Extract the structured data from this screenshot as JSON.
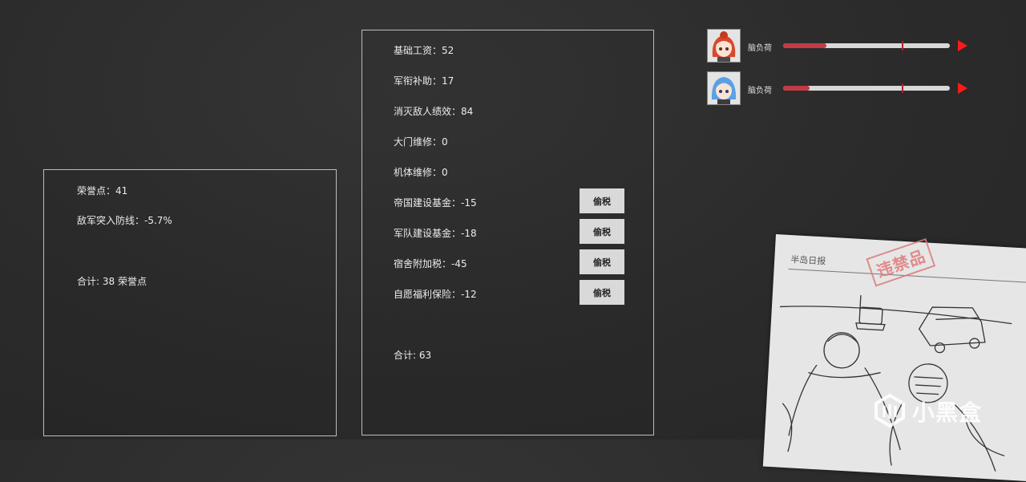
{
  "honor_panel": {
    "lines": [
      "荣誉点：41",
      "敌军突入防线：-5.7%"
    ],
    "total": "合计: 38 荣誉点"
  },
  "salary_panel": {
    "lines": [
      "基础工资：52",
      "军衔补助：17",
      "消灭敌人绩效：84",
      "大门维修：0",
      "机体维修：0",
      "帝国建设基金：-15",
      "军队建设基金：-18",
      "宿舍附加税：-45",
      "自愿福利保险：-12"
    ],
    "evade_button_label": "偷税",
    "total": "合计: 63"
  },
  "characters": [
    {
      "label": "脑负荷",
      "load_fraction": 0.26,
      "avatar_hair": "#d8482c",
      "icon": "red-haired-girl-avatar"
    },
    {
      "label": "脑负荷",
      "load_fraction": 0.16,
      "avatar_hair": "#5aa0e6",
      "icon": "blue-haired-girl-avatar"
    }
  ],
  "newspaper": {
    "title": "半岛日报",
    "stamp": "违禁品"
  },
  "watermark": {
    "text": "小黑盒"
  }
}
